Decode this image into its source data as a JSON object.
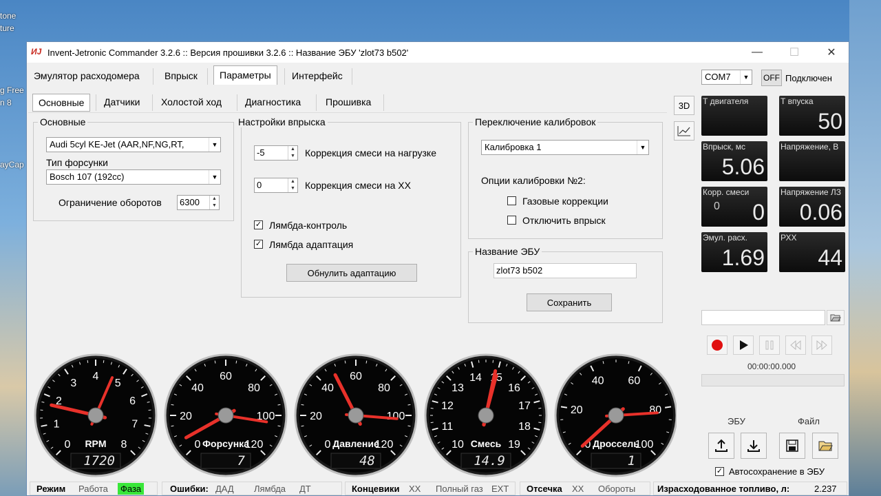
{
  "desktop": {
    "left_labels": [
      "tone",
      "ture",
      "g Free",
      "n 8",
      "ayCap"
    ]
  },
  "window": {
    "title": "Invent-Jetronic Commander 3.2.6 :: Версия прошивки 3.2.6 :: Название ЭБУ 'zlot73 b502'",
    "icon_text": "ИJ",
    "minimize": "—",
    "maximize": "☐",
    "close": "✕"
  },
  "main_tabs": [
    {
      "label": "Эмулятор расходомера"
    },
    {
      "label": "Впрыск"
    },
    {
      "label": "Параметры"
    },
    {
      "label": "Интерфейс"
    }
  ],
  "sub_tabs": [
    {
      "label": "Основные"
    },
    {
      "label": "Датчики"
    },
    {
      "label": "Холостой ход"
    },
    {
      "label": "Диагностика"
    },
    {
      "label": "Прошивка"
    }
  ],
  "basic": {
    "group_label": "Основные",
    "engine": "Audi 5cyl KE-Jet (AAR,NF,NG,RT,",
    "injector_label": "Тип форсунки",
    "injector": "Bosch 107 (192cc)",
    "rpm_limit_label": "Ограничение оборотов",
    "rpm_limit": "6300"
  },
  "injection": {
    "group_label": "Настройки впрыска",
    "load_corr": "-5",
    "load_corr_label": "Коррекция смеси на нагрузке",
    "idle_corr": "0",
    "idle_corr_label": "Коррекция смеси на ХХ",
    "lambda_control_label": "Лямбда-контроль",
    "lambda_control_checked": true,
    "lambda_adapt_label": "Лямбда адаптация",
    "lambda_adapt_checked": true,
    "reset_button": "Обнулить адаптацию"
  },
  "calibration": {
    "group_label": "Переключение калибровок",
    "selected": "Калибровка 1",
    "options_label": "Опции калибровки №2:",
    "gas_corr_label": "Газовые коррекции",
    "disable_inj_label": "Отключить впрыск"
  },
  "ecu_name": {
    "group_label": "Название ЭБУ",
    "value": "zlot73 b502",
    "save_button": "Сохранить"
  },
  "connection": {
    "port": "COM7",
    "toggle": "OFF",
    "status": "Подключен"
  },
  "side_buttons": {
    "three_d": "3D"
  },
  "tiles": [
    {
      "label": "Т двигателя",
      "value": "",
      "sub": ""
    },
    {
      "label": "Т впуска",
      "value": "50",
      "sub": ""
    },
    {
      "label": "Впрыск, мс",
      "value": "5.06",
      "sub": ""
    },
    {
      "label": "Напряжение, В",
      "value": "",
      "sub": ""
    },
    {
      "label": "Корр. смеси",
      "value": "0",
      "sub": "0"
    },
    {
      "label": "Напряжение ЛЗ",
      "value": "0.06",
      "sub": ""
    },
    {
      "label": "Эмул. расх.",
      "value": "1.69",
      "sub": ""
    },
    {
      "label": "РХХ",
      "value": "44",
      "sub": ""
    }
  ],
  "playback": {
    "time": "00:00:00.000",
    "progress": 0
  },
  "file_section": {
    "ecu_label": "ЭБУ",
    "file_label": "Файл",
    "autosave_label": "Автосохранение в ЭБУ",
    "autosave_checked": true
  },
  "gauges": [
    {
      "name": "RPM",
      "ticks": [
        "0",
        "1",
        "2",
        "3",
        "4",
        "5",
        "6",
        "7",
        "8"
      ],
      "min": 0,
      "max": 8,
      "digital": "1720",
      "needles": [
        1.72,
        4.7
      ]
    },
    {
      "name": "Форсунка",
      "ticks": [
        "0",
        "20",
        "40",
        "60",
        "80",
        "100",
        "120"
      ],
      "min": 0,
      "max": 120,
      "digital": "7",
      "needles": [
        7,
        104
      ]
    },
    {
      "name": "Давление",
      "ticks": [
        "0",
        "20",
        "40",
        "60",
        "80",
        "100",
        "120"
      ],
      "min": 0,
      "max": 120,
      "digital": "48",
      "needles": [
        48,
        102
      ]
    },
    {
      "name": "Смесь",
      "ticks": [
        "10",
        "11",
        "12",
        "13",
        "14",
        "15",
        "16",
        "17",
        "18",
        "19"
      ],
      "min": 10,
      "max": 19,
      "digital": "14.9",
      "needles": [
        14.9,
        15
      ]
    },
    {
      "name": "Дроссель",
      "ticks": [
        "0",
        "20",
        "40",
        "60",
        "80",
        "100"
      ],
      "min": 0,
      "max": 100,
      "digital": "1",
      "needles": [
        1,
        82
      ]
    }
  ],
  "status": {
    "mode_label": "Режим",
    "mode_work": "Работа",
    "mode_phase": "Фаза",
    "errors_label": "Ошибки:",
    "err_dad": "ДАД",
    "err_lambda": "Лямбда",
    "err_dt": "ДТ",
    "limits_label": "Концевики",
    "limit_xx": "XX",
    "limit_full": "Полный газ",
    "limit_ext": "EXT",
    "cutoff_label": "Отсечка",
    "cutoff_xx": "XX",
    "cutoff_rpm": "Обороты",
    "fuel_label": "Израсходованное топливо, л:",
    "fuel_value": "2.237"
  },
  "colors": {
    "phase_bg": "#39e639",
    "record": "#e01010",
    "needle": "#e8312a"
  }
}
